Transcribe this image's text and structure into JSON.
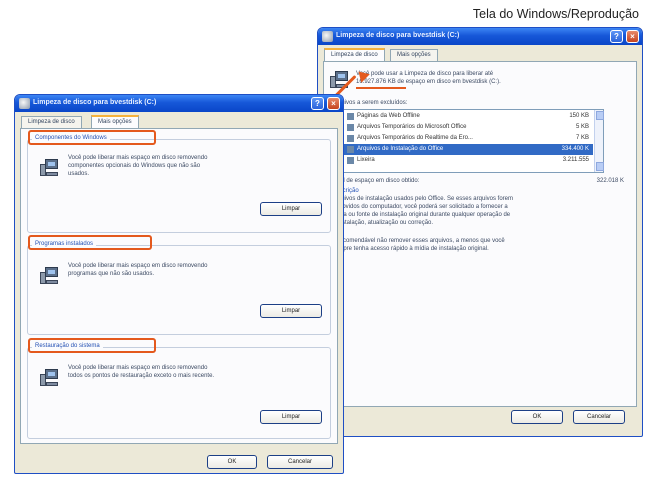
{
  "credit": "Tela do Windows/Reprodução",
  "right_window": {
    "title": "Limpeza de disco para bvestdisk (C:)",
    "tabs": [
      "Limpeza de disco",
      "Mais opções"
    ],
    "intro": [
      "Você pode usar a Limpeza de disco para liberar até",
      "16.927.876 KB de espaço em disco em bvestdisk (C:)."
    ],
    "files_label": "Arquivos a serem excluídos:",
    "files": [
      {
        "name": "Páginas da Web Offline",
        "size": "150 KB",
        "checked": false,
        "selected": false
      },
      {
        "name": "Arquivos Temporários do Microsoft Office",
        "size": "5 KB",
        "checked": false,
        "selected": false
      },
      {
        "name": "Arquivos Temporários do Realtime da Ero...",
        "size": "7 KB",
        "checked": false,
        "selected": false
      },
      {
        "name": "Arquivos de Instalação do Office",
        "size": "334.400 K",
        "checked": true,
        "selected": true
      },
      {
        "name": "Lixeira",
        "size": "3.211.555",
        "checked": false,
        "selected": false
      }
    ],
    "total_label": "Total de espaço em disco obtido:",
    "total_value": "322.018 K",
    "description_title": "Descrição",
    "description": [
      "Arquivos de instalação usados pelo Office. Se esses arquivos forem",
      "removidos do computador, você poderá ser solicitado a fornecer a",
      "mídia ou fonte de instalação original durante qualquer operação de",
      "reinstalação, atualização ou correção."
    ],
    "note": [
      "É recomendável não remover esses arquivos, a menos que você",
      "sempre tenha acesso rápido à mídia de instalação original."
    ],
    "ok_label": "OK",
    "cancel_label": "Cancelar"
  },
  "left_window": {
    "title": "Limpeza de disco para bvestdisk (C:)",
    "tabs": [
      "Limpeza de disco",
      "Mais opções"
    ],
    "groups": [
      {
        "title": "Componentes do Windows",
        "desc": [
          "Você pode liberar mais espaço em disco removendo",
          "componentes opcionais do Windows que não são",
          "usados."
        ],
        "button": "Limpar"
      },
      {
        "title": "Programas instalados",
        "desc": [
          "Você pode liberar mais espaço em disco removendo",
          "programas que não são usados."
        ],
        "button": "Limpar"
      },
      {
        "title": "Restauração do sistema",
        "desc": [
          "Você pode liberar mais espaço em disco removendo",
          "todos os pontos de restauração exceto o mais recente."
        ],
        "button": "Limpar"
      }
    ],
    "ok_label": "OK",
    "cancel_label": "Cancelar"
  }
}
